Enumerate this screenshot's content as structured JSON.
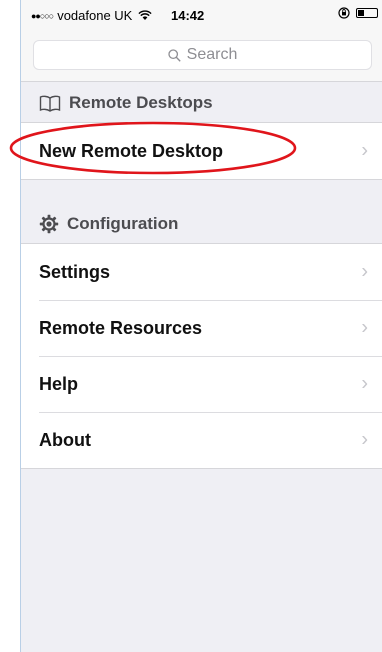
{
  "status_bar": {
    "signal": "●●○○○",
    "carrier": "vodafone UK",
    "wifi_icon": "wifi-icon",
    "time": "14:42",
    "orientation_lock_icon": "orientation-lock-icon",
    "battery_level": 0.35
  },
  "search": {
    "placeholder": "Search"
  },
  "sections": {
    "remote_desktops": {
      "title": "Remote Desktops",
      "icon": "book-icon",
      "items": [
        {
          "label": "New Remote Desktop"
        }
      ]
    },
    "configuration": {
      "title": "Configuration",
      "icon": "gear-icon",
      "items": [
        {
          "label": "Settings"
        },
        {
          "label": "Remote Resources"
        },
        {
          "label": "Help"
        },
        {
          "label": "About"
        }
      ]
    }
  },
  "annotation": {
    "color": "#e0151b"
  },
  "chevron_glyph": "›"
}
